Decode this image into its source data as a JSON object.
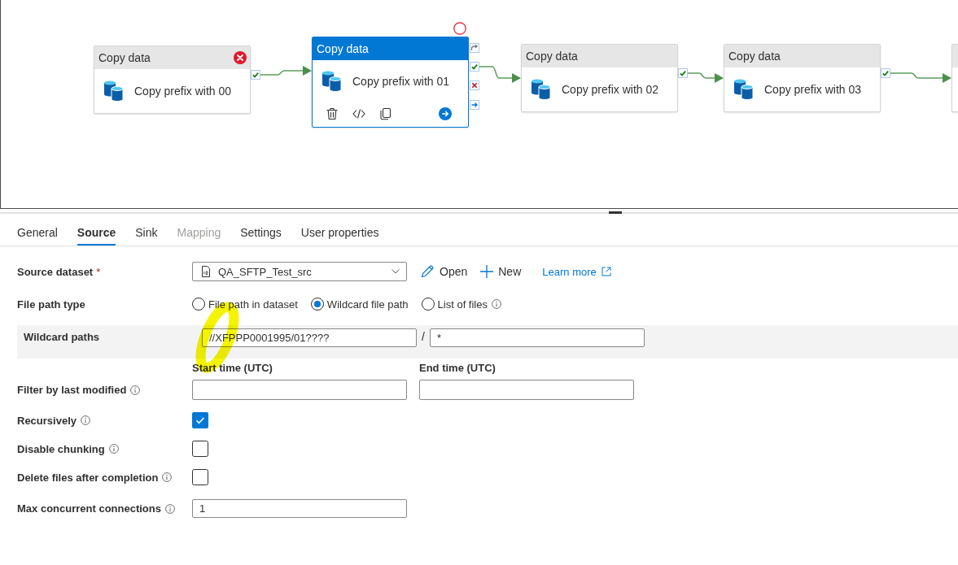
{
  "pipeline": {
    "nodes": [
      {
        "type_label": "Copy data",
        "name": "Copy prefix with 00",
        "error": true,
        "selected": false
      },
      {
        "type_label": "Copy data",
        "name": "Copy prefix with 01",
        "error": false,
        "selected": true
      },
      {
        "type_label": "Copy data",
        "name": "Copy prefix with 02",
        "error": false,
        "selected": false
      },
      {
        "type_label": "Copy data",
        "name": "Copy prefix with 03",
        "error": false,
        "selected": false
      }
    ],
    "cut_off_node": true
  },
  "tabs": [
    {
      "label": "General",
      "selected": false,
      "disabled": false
    },
    {
      "label": "Source",
      "selected": true,
      "disabled": false
    },
    {
      "label": "Sink",
      "selected": false,
      "disabled": false
    },
    {
      "label": "Mapping",
      "selected": false,
      "disabled": true
    },
    {
      "label": "Settings",
      "selected": false,
      "disabled": false
    },
    {
      "label": "User properties",
      "selected": false,
      "disabled": false
    }
  ],
  "source": {
    "fields": [
      {
        "kind": "dataset",
        "label": "Source dataset",
        "required_mark": "*",
        "info": false,
        "value": "QA_SFTP_Test_src",
        "actions": [
          {
            "kind": "edit",
            "label": "Open"
          },
          {
            "kind": "add",
            "label": "New"
          }
        ],
        "link": "Learn more"
      },
      {
        "kind": "radio",
        "label": "File path type",
        "info": false,
        "options": [
          {
            "label": "File path in dataset",
            "selected": false,
            "info": false
          },
          {
            "label": "Wildcard file path",
            "selected": true,
            "info": false
          },
          {
            "label": "List of files",
            "selected": false,
            "info": true
          }
        ]
      },
      {
        "kind": "wildcard",
        "label": "Wildcard paths",
        "info": false,
        "folder_path": "//XFPPP0001995/01????",
        "separator": "/",
        "file_name": "*"
      },
      {
        "kind": "time_range",
        "label": "Filter by last modified",
        "info": true,
        "start_label": "Start time (UTC)",
        "end_label": "End time (UTC)"
      },
      {
        "kind": "checkbox",
        "label": "Recursively",
        "info": true,
        "checked": true
      },
      {
        "kind": "checkbox",
        "label": "Disable chunking",
        "info": true,
        "checked": false
      },
      {
        "kind": "checkbox",
        "label": "Delete files after completion",
        "info": true,
        "checked": false
      },
      {
        "kind": "text",
        "label": "Max concurrent connections",
        "info": true,
        "value": "1"
      }
    ]
  }
}
